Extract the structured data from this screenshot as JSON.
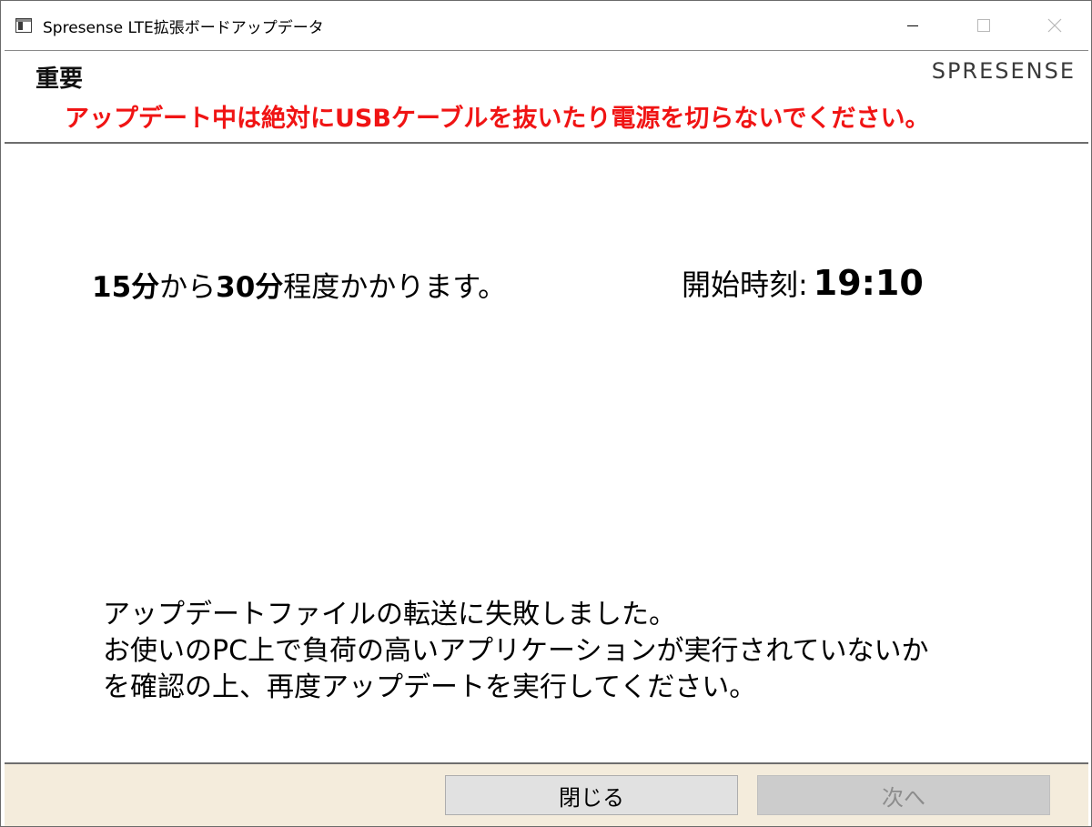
{
  "window": {
    "title": "Spresense LTE拡張ボードアップデータ"
  },
  "header": {
    "title": "重要",
    "brand": "SPRESENSE",
    "warning": "アップデート中は絶対にUSBケーブルを抜いたり電源を切らないでください。",
    "warning_color": "#f01414"
  },
  "main": {
    "duration": {
      "min": "15分",
      "from": "から",
      "max": "30分",
      "suffix": "程度かかります。"
    },
    "start": {
      "label": "開始時刻:",
      "time": "19:10"
    },
    "message": {
      "line1": "アップデートファイルの転送に失敗しました。",
      "line2": "お使いのPC上で負荷の高いアプリケーションが実行されていないか",
      "line3": "を確認の上、再度アップデートを実行してください。"
    }
  },
  "footer": {
    "close_label": "閉じる",
    "next_label": "次へ",
    "background": "#f4ecdc"
  },
  "icons": {
    "app": "window-app-icon",
    "minimize": "minimize-icon",
    "maximize": "maximize-icon",
    "close": "close-icon"
  }
}
